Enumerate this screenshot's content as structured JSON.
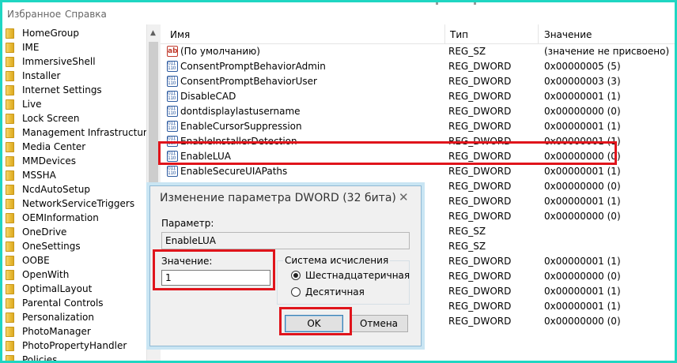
{
  "menu": {
    "items": [
      {
        "label": "Избранное"
      },
      {
        "label": "Справка"
      }
    ]
  },
  "tree": {
    "items": [
      {
        "label": "HomeGroup"
      },
      {
        "label": "IME"
      },
      {
        "label": "ImmersiveShell"
      },
      {
        "label": "Installer"
      },
      {
        "label": "Internet Settings"
      },
      {
        "label": "Live"
      },
      {
        "label": "Lock Screen"
      },
      {
        "label": "Management Infrastructure"
      },
      {
        "label": "Media Center"
      },
      {
        "label": "MMDevices"
      },
      {
        "label": "MSSHA"
      },
      {
        "label": "NcdAutoSetup"
      },
      {
        "label": "NetworkServiceTriggers"
      },
      {
        "label": "OEMInformation"
      },
      {
        "label": "OneDrive"
      },
      {
        "label": "OneSettings"
      },
      {
        "label": "OOBE"
      },
      {
        "label": "OpenWith"
      },
      {
        "label": "OptimalLayout"
      },
      {
        "label": "Parental Controls"
      },
      {
        "label": "Personalization"
      },
      {
        "label": "PhotoManager"
      },
      {
        "label": "PhotoPropertyHandler"
      },
      {
        "label": "Policies"
      }
    ]
  },
  "values": {
    "columns": {
      "name": "Имя",
      "type": "Тип",
      "data": "Значение"
    },
    "rows": [
      {
        "icon": "string-value-icon",
        "icon_text": "ab",
        "name": "(По умолчанию)",
        "type": "REG_SZ",
        "data": "(значение не присвоено)"
      },
      {
        "icon": "dword-value-icon",
        "name": "ConsentPromptBehaviorAdmin",
        "type": "REG_DWORD",
        "data": "0x00000005 (5)"
      },
      {
        "icon": "dword-value-icon",
        "name": "ConsentPromptBehaviorUser",
        "type": "REG_DWORD",
        "data": "0x00000003 (3)"
      },
      {
        "icon": "dword-value-icon",
        "name": "DisableCAD",
        "type": "REG_DWORD",
        "data": "0x00000001 (1)"
      },
      {
        "icon": "dword-value-icon",
        "name": "dontdisplaylastusername",
        "type": "REG_DWORD",
        "data": "0x00000000 (0)"
      },
      {
        "icon": "dword-value-icon",
        "name": "EnableCursorSuppression",
        "type": "REG_DWORD",
        "data": "0x00000001 (1)"
      },
      {
        "icon": "dword-value-icon",
        "name": "EnableInstallerDetection",
        "type": "REG_DWORD",
        "data": "0x00000001 (1)"
      },
      {
        "icon": "dword-value-icon",
        "name": "EnableLUA",
        "type": "REG_DWORD",
        "data": "0x00000000 (0)"
      },
      {
        "icon": "dword-value-icon",
        "name": "EnableSecureUIAPaths",
        "type": "REG_DWORD",
        "data": "0x00000001 (1)"
      },
      {
        "icon": "dword-value-icon",
        "name": "",
        "type": "REG_DWORD",
        "data": "0x00000000 (0)"
      },
      {
        "icon": "dword-value-icon",
        "name": "",
        "type": "REG_DWORD",
        "data": "0x00000001 (1)"
      },
      {
        "icon": "dword-value-icon",
        "name": "",
        "type": "REG_DWORD",
        "data": "0x00000000 (0)"
      },
      {
        "icon": "string-value-icon",
        "name": "",
        "type": "REG_SZ",
        "data": ""
      },
      {
        "icon": "string-value-icon",
        "name": "",
        "type": "REG_SZ",
        "data": ""
      },
      {
        "icon": "dword-value-icon",
        "name": "",
        "type": "REG_DWORD",
        "data": "0x00000001 (1)"
      },
      {
        "icon": "dword-value-icon",
        "name": "",
        "type": "REG_DWORD",
        "data": "0x00000000 (0)"
      },
      {
        "icon": "dword-value-icon",
        "name": "",
        "type": "REG_DWORD",
        "data": "0x00000001 (1)"
      },
      {
        "icon": "dword-value-icon",
        "name": "",
        "type": "REG_DWORD",
        "data": "0x00000001 (1)"
      },
      {
        "icon": "dword-value-icon",
        "name": "",
        "type": "REG_DWORD",
        "data": "0x00000000 (0)"
      }
    ]
  },
  "dialog": {
    "title": "Изменение параметра DWORD (32 бита)",
    "close_icon": "✕",
    "param_label": "Параметр:",
    "param_value": "EnableLUA",
    "value_label": "Значение:",
    "value_input": "1",
    "base_label": "Система исчисления",
    "base_options": [
      {
        "label": "Шестнадцатеричная",
        "checked": true
      },
      {
        "label": "Десятичная",
        "checked": false
      }
    ],
    "ok_label": "OK",
    "cancel_label": "Отмена"
  },
  "colors": {
    "background_border": "#1fd6c2",
    "highlight": "#e0141b"
  }
}
